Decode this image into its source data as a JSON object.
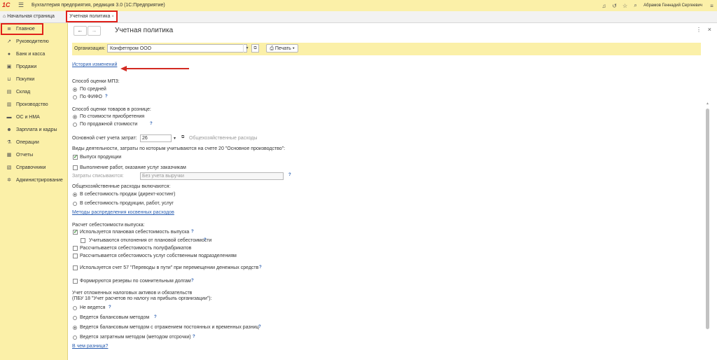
{
  "titlebar": {
    "logo": "1С",
    "title": "Бухгалтерия предприятия, редакция 3.0  (1С:Предприятие)",
    "user": "Абрамов Геннадий Сергеевич"
  },
  "tabs": [
    {
      "label": "Начальная страница"
    },
    {
      "label": "Учетная политика",
      "active": true
    }
  ],
  "sidebar": {
    "items": [
      {
        "label": "Главное",
        "icon": "list-icon"
      },
      {
        "label": "Руководителю",
        "icon": "chart-icon"
      },
      {
        "label": "Банк и касса",
        "icon": "coin-icon"
      },
      {
        "label": "Продажи",
        "icon": "bag-icon"
      },
      {
        "label": "Покупки",
        "icon": "cart-icon"
      },
      {
        "label": "Склад",
        "icon": "box-icon"
      },
      {
        "label": "Производство",
        "icon": "factory-icon"
      },
      {
        "label": "ОС и НМА",
        "icon": "truck-icon"
      },
      {
        "label": "Зарплата и кадры",
        "icon": "people-icon"
      },
      {
        "label": "Операции",
        "icon": "ops-icon"
      },
      {
        "label": "Отчеты",
        "icon": "report-icon"
      },
      {
        "label": "Справочники",
        "icon": "book-icon"
      },
      {
        "label": "Администрирование",
        "icon": "gear-icon"
      }
    ]
  },
  "form": {
    "title": "Учетная политика",
    "org_label": "Организация:",
    "org_value": "Конфетпром ООО",
    "print_label": "Печать",
    "history_link": "История изменений",
    "mpz_title": "Способ оценки МПЗ:",
    "mpz_opt1": "По средней",
    "mpz_opt2": "По ФИФО",
    "retail_title": "Способ оценки товаров в рознице:",
    "retail_opt1": "По стоимости приобретения",
    "retail_opt2": "По продажной стоимости",
    "cost_account_label": "Основной счет учета затрат:",
    "cost_account_value": "26",
    "cost_account_desc": "Общехозяйственные расходы",
    "activities_title": "Виды деятельности, затраты по которым учитываются на счете 20 \"Основное производство\":",
    "act1": "Выпуск продукции",
    "act2": "Выполнение работ, оказание услуг заказчикам",
    "writeoff_label": "Затраты списываются:",
    "writeoff_value": "Без учета выручки",
    "overhead_title": "Общехозяйственные расходы включаются:",
    "overhead_opt1": "В себестоимость продаж (директ-костинг)",
    "overhead_opt2": "В  себестоимость продукции, работ, услуг",
    "distribution_link": "Методы распределения косвенных расходов",
    "calc_title": "Расчет себестоимости выпуска:",
    "calc1": "Используется плановая себестоимость выпуска",
    "calc2": "Учитываются отклонения от плановой себестоимости",
    "calc3": "Рассчитывается себестоимость полуфабрикатов",
    "calc4": "Рассчитывается себестоимость услуг собственным подразделениям",
    "transit": "Используется счет 57 \"Переводы в пути\" при перемещении денежных средств",
    "reserves": "Формируются резервы по сомнительным долгам",
    "pbu_title1": "Учет отложенных налоговых активов и обязательств",
    "pbu_title2": "(ПБУ 18 \"Учет расчетов по налогу на прибыль организации\"):",
    "pbu1": "Не ведется",
    "pbu2": "Ведется балансовым методом",
    "pbu3": "Ведется балансовым методом с отражением постоянных и временных разниц",
    "pbu4": "Ведется затратным методом (методом отсрочки)",
    "diff_link": "В чем разница?",
    "q": "?"
  },
  "colors": {
    "accent_yellow": "#fbf0a8",
    "link": "#2a5eb1",
    "highlight_red": "#e0201a"
  }
}
